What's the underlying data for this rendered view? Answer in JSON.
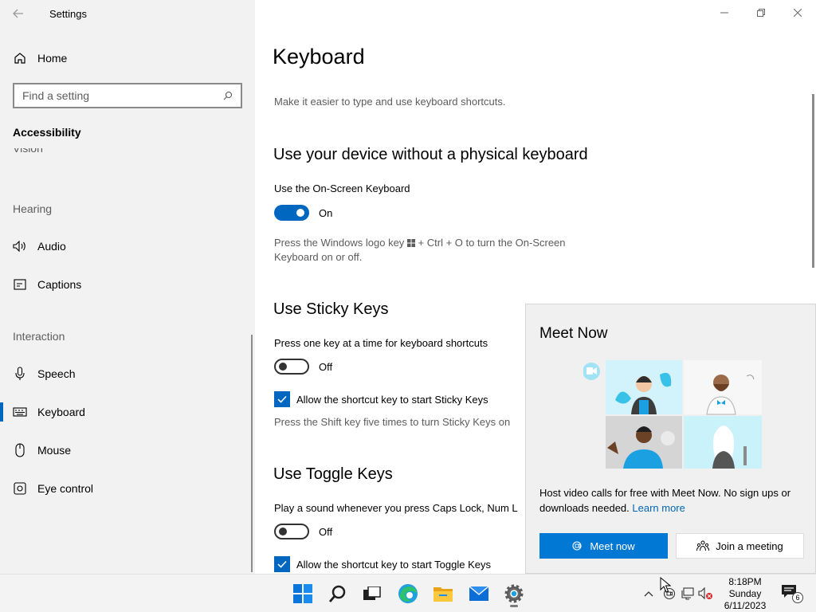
{
  "window": {
    "title": "Settings",
    "back_icon": "back-arrow-icon",
    "controls": [
      "minimize-icon",
      "restore-icon",
      "close-icon"
    ]
  },
  "sidebar": {
    "home_label": "Home",
    "search_placeholder": "Find a setting",
    "category": "Accessibility",
    "vision_label": "Vision",
    "hearing_label": "Hearing",
    "interaction_label": "Interaction",
    "items": [
      {
        "label": "Audio",
        "icon": "speaker-icon"
      },
      {
        "label": "Captions",
        "icon": "captions-icon"
      },
      {
        "label": "Speech",
        "icon": "microphone-icon"
      },
      {
        "label": "Keyboard",
        "icon": "keyboard-icon",
        "active": true
      },
      {
        "label": "Mouse",
        "icon": "mouse-icon"
      },
      {
        "label": "Eye control",
        "icon": "eye-control-icon"
      }
    ]
  },
  "main": {
    "title": "Keyboard",
    "subtitle": "Make it easier to type and use keyboard shortcuts.",
    "osk": {
      "heading": "Use your device without a physical keyboard",
      "label": "Use the On-Screen Keyboard",
      "state": "On",
      "desc_a": "Press the Windows logo key",
      "desc_b": "+ Ctrl + O to turn the On-Screen",
      "desc_c": "Keyboard on or off."
    },
    "sticky": {
      "heading": "Use Sticky Keys",
      "label": "Press one key at a time for keyboard shortcuts",
      "state": "Off",
      "checkbox_label": "Allow the shortcut key to start Sticky Keys",
      "desc": "Press the Shift key five times to turn Sticky Keys on"
    },
    "toggle_keys": {
      "heading": "Use Toggle Keys",
      "label": "Play a sound whenever you press Caps Lock, Num L",
      "state": "Off",
      "checkbox_label": "Allow the shortcut key to start Toggle Keys"
    }
  },
  "meet_now": {
    "title": "Meet Now",
    "desc": "Host video calls for free with Meet Now. No sign ups or downloads needed.",
    "link": "Learn more",
    "primary_button": "Meet now",
    "secondary_button": "Join a meeting"
  },
  "taskbar": {
    "apps": [
      "windows-start-icon",
      "search-icon",
      "task-view-icon",
      "edge-icon",
      "file-explorer-icon",
      "mail-icon",
      "settings-gear-icon"
    ],
    "tray": [
      "chevron-up-icon",
      "meet-now-icon",
      "network-icon",
      "volume-muted-icon"
    ],
    "time": "8:18PM",
    "day": "Sunday",
    "date": "6/11/2023",
    "notification_count": "6"
  },
  "colors": {
    "accent": "#0067c0",
    "button_blue": "#0078d4",
    "link": "#0066b4",
    "sidebar_bg": "#f2f2f2"
  }
}
